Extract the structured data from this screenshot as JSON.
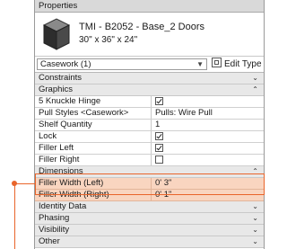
{
  "palette": {
    "highlight_fill": "#f9d5c0",
    "highlight_border": "#e9652b",
    "group_bg": "#e8e8e8",
    "title_bg": "#d9d9d9"
  },
  "panel": {
    "title": "Properties"
  },
  "type": {
    "name": "TMI - B2052 - Base_2 Doors",
    "size": "30\" x 36\" x 24\"",
    "icon": "cabinet-3d-icon"
  },
  "selector": {
    "value": "Casework (1)",
    "edit_type_label": "Edit Type",
    "edit_type_icon": "edit-type-icon"
  },
  "groups": {
    "constraints": "Constraints",
    "graphics": "Graphics",
    "dimensions": "Dimensions",
    "identity": "Identity Data",
    "phasing": "Phasing",
    "visibility": "Visibility",
    "other": "Other"
  },
  "graphics_rows": [
    {
      "label": "5 Knuckle Hinge",
      "checked": true
    },
    {
      "label": "Pull Styles <Casework>",
      "value": "Pulls: Wire Pull"
    },
    {
      "label": "Shelf Quantity",
      "value": "1"
    },
    {
      "label": "Lock",
      "checked": true
    },
    {
      "label": "Filler Left",
      "checked": true
    },
    {
      "label": "Filler Right",
      "checked": false
    }
  ],
  "dimension_rows": [
    {
      "label": "Filler Width (Left)",
      "value": "0'  3\""
    },
    {
      "label": "Filler Width (Right)",
      "value": "0'  1\""
    }
  ]
}
